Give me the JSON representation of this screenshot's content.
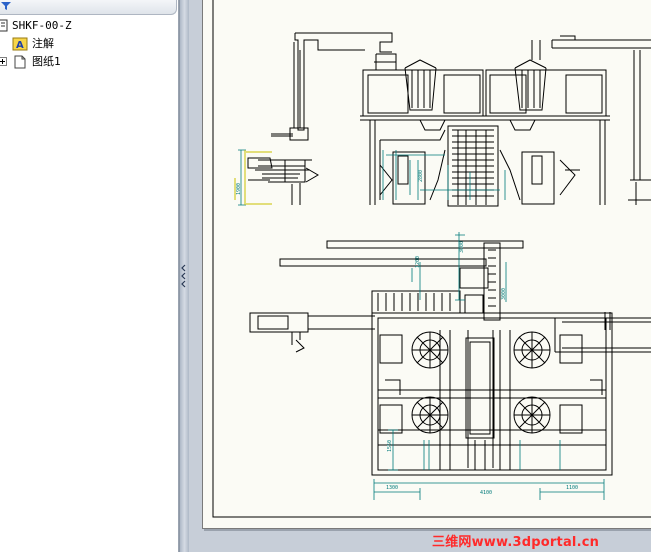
{
  "tree": {
    "items": [
      {
        "label": "SHKF-00-Z",
        "icon": "assembly-drawing-icon"
      },
      {
        "label": "注解",
        "icon": "annotation-folder-icon"
      },
      {
        "label": "图纸1",
        "icon": "sheet-icon"
      }
    ]
  },
  "drawing": {
    "dim_labels": [
      "1300",
      "1100",
      "4100",
      "1900",
      "1550",
      "1200",
      "3600",
      "3000",
      "2800"
    ]
  },
  "watermark": {
    "text": "三维网www.3dportal.cn"
  },
  "colors": {
    "drawing_line": "#000000",
    "dim_line": "#007a7a",
    "dim_fill": "#c8c200",
    "watermark": "#ff2a2a"
  }
}
